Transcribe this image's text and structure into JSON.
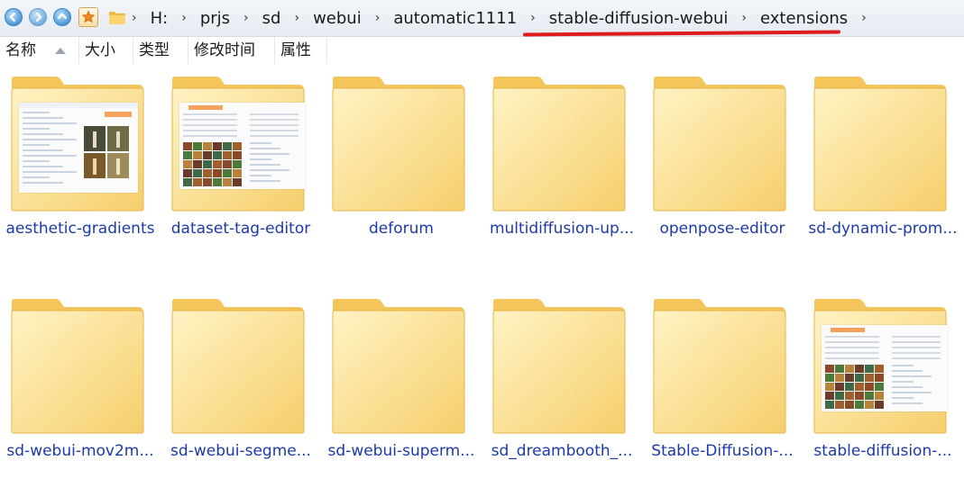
{
  "address_bar": {
    "breadcrumbs": [
      "H:",
      "prjs",
      "sd",
      "webui",
      "automatic1111",
      "stable-diffusion-webui",
      "extensions"
    ]
  },
  "columns": [
    "名称",
    "大小",
    "类型",
    "修改时间",
    "属性"
  ],
  "folders": [
    {
      "name": "aesthetic-gradients",
      "thumbnail": "webui-screenshot-lighthouse"
    },
    {
      "name": "dataset-tag-editor",
      "thumbnail": "webui-screenshot-image-grid"
    },
    {
      "name": "deforum",
      "thumbnail": ""
    },
    {
      "name": "multidiffusion-up...",
      "thumbnail": ""
    },
    {
      "name": "openpose-editor",
      "thumbnail": ""
    },
    {
      "name": "sd-dynamic-prom...",
      "thumbnail": ""
    },
    {
      "name": "sd-webui-mov2m...",
      "thumbnail": ""
    },
    {
      "name": "sd-webui-segme...",
      "thumbnail": ""
    },
    {
      "name": "sd-webui-superm...",
      "thumbnail": ""
    },
    {
      "name": "sd_dreambooth_...",
      "thumbnail": ""
    },
    {
      "name": "Stable-Diffusion-...",
      "thumbnail": ""
    },
    {
      "name": "stable-diffusion-...",
      "thumbnail": "webui-screenshot-image-grid"
    }
  ],
  "colors": {
    "folder_back": "#f3c55a",
    "folder_front": "#fde9a6",
    "link_text": "#1c3aa9",
    "annotation_underline": "#e01b1b"
  }
}
